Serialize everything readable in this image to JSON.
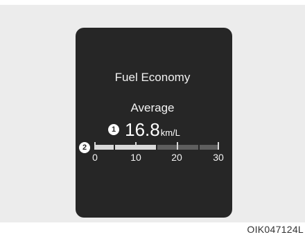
{
  "display": {
    "title": "Fuel Economy",
    "subtitle": "Average",
    "value": "16.8",
    "unit": "km/L",
    "marker_value": "1",
    "marker_bar": "2"
  },
  "gauge": {
    "ticks": [
      "0",
      "10",
      "20",
      "30"
    ],
    "min": 0,
    "max": 30,
    "level": 16.8
  },
  "figure_code": "OIK047124L"
}
